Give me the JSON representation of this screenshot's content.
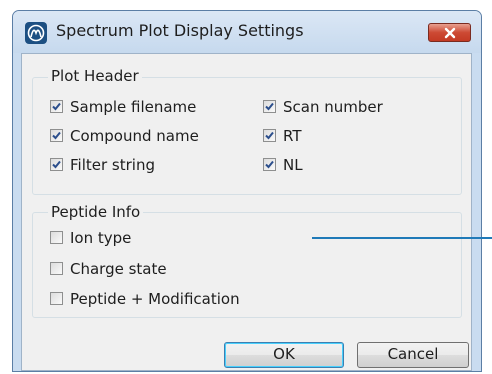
{
  "window": {
    "title": "Spectrum Plot Display Settings",
    "icon": "app-logo-icon",
    "close_icon": "close-icon"
  },
  "plot_header": {
    "legend": "Plot Header",
    "items": [
      {
        "label": "Sample filename",
        "checked": true
      },
      {
        "label": "Scan number",
        "checked": true
      },
      {
        "label": "Compound name",
        "checked": true
      },
      {
        "label": "RT",
        "checked": true
      },
      {
        "label": "Filter string",
        "checked": true
      },
      {
        "label": "NL",
        "checked": true
      }
    ]
  },
  "peptide_info": {
    "legend": "Peptide Info",
    "items": [
      {
        "label": "Ion type",
        "checked": false
      },
      {
        "label": "Charge state",
        "checked": false
      },
      {
        "label": "Peptide + Modification",
        "checked": false
      }
    ]
  },
  "buttons": {
    "ok": "OK",
    "cancel": "Cancel"
  },
  "colors": {
    "titlebar": "#c6d9ee",
    "close_button": "#cd4a34",
    "callout_line": "#1f7ab8"
  }
}
